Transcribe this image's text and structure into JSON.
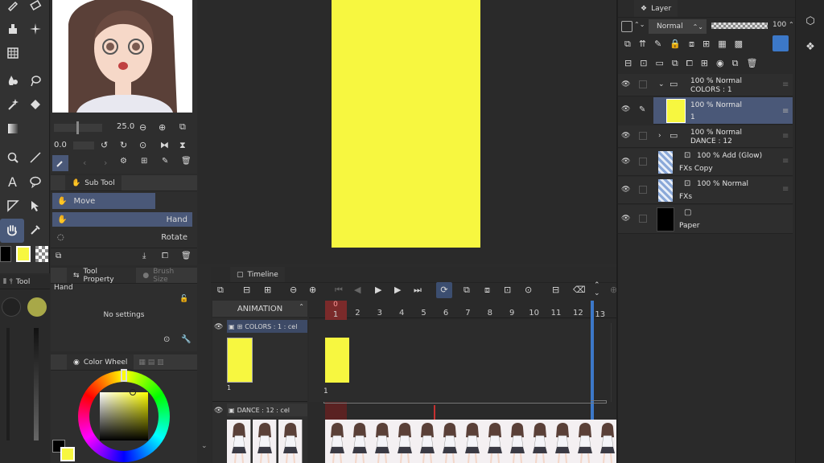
{
  "sub_tool": {
    "tab_label": "Sub Tool",
    "items": [
      {
        "label": "Move"
      },
      {
        "label": "Hand"
      },
      {
        "label": "Rotate"
      }
    ]
  },
  "brush": {
    "size_value": "25.0",
    "opacity_value": "0.0"
  },
  "tool_property": {
    "tab_label": "Tool Property",
    "tab2_label": "Brush Size",
    "tool_name": "Hand",
    "no_settings": "No settings"
  },
  "color_wheel": {
    "tab_label": "Color Wheel",
    "main_color": "#f7f740",
    "sub_color": "#000000",
    "accent": "#b0b040"
  },
  "left_strip": {
    "tab_label": "Tool"
  },
  "layer_panel": {
    "tab_label": "Layer",
    "blend_mode": "Normal",
    "opacity": "100",
    "layers": [
      {
        "opacity": "100 %",
        "mode": "Normal",
        "name": "COLORS : 1"
      },
      {
        "opacity": "100 %",
        "mode": "Normal",
        "name": "1"
      },
      {
        "opacity": "100 %",
        "mode": "Normal",
        "name": "DANCE : 12"
      },
      {
        "opacity": "100 %",
        "mode": "Add (Glow)",
        "name": "FXs Copy"
      },
      {
        "opacity": "100 %",
        "mode": "Normal",
        "name": "FXs"
      },
      {
        "opacity": "",
        "mode": "",
        "name": "Paper"
      }
    ]
  },
  "timeline": {
    "tab_label": "Timeline",
    "track_name": "ANIMATION",
    "tracks": [
      {
        "label": "COLORS : 1 : cel",
        "cel_label": "1"
      },
      {
        "label": "DANCE : 12 : cel"
      }
    ],
    "current_frame": "0",
    "frames": [
      "1",
      "2",
      "3",
      "4",
      "5",
      "6",
      "7",
      "8",
      "9",
      "10",
      "11",
      "12",
      "13"
    ],
    "cel_marker": "1"
  },
  "colors": {
    "canvas_yellow": "#f7f740",
    "accent_blue": "#3c78c8",
    "playhead_red": "#c83030"
  }
}
